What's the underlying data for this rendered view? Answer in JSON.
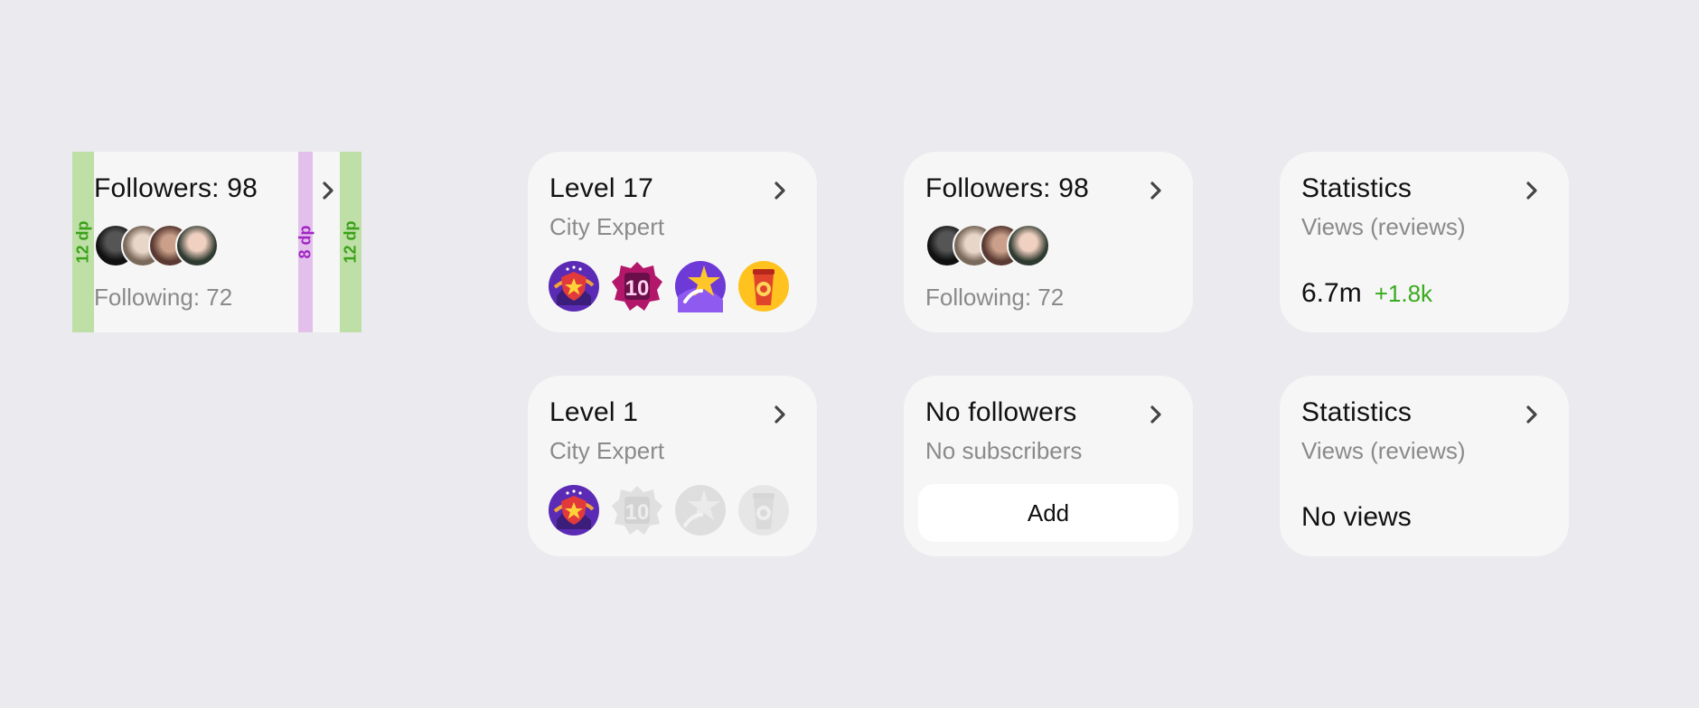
{
  "spec": {
    "title": "Followers: 98",
    "following": "Following: 72",
    "pad_left_label": "12 dp",
    "gap_label": "8 dp",
    "pad_right_label": "12 dp"
  },
  "cards": {
    "level17": {
      "title": "Level 17",
      "subtitle": "City Expert"
    },
    "followers": {
      "title": "Followers: 98",
      "following": "Following: 72"
    },
    "stats": {
      "title": "Statistics",
      "subtitle": "Views (reviews)",
      "value": "6.7m",
      "delta": "+1.8k"
    },
    "level1": {
      "title": "Level 1",
      "subtitle": "City Expert"
    },
    "nofollowers": {
      "title": "No followers",
      "subtitle": "No subscribers",
      "button": "Add"
    },
    "stats_empty": {
      "title": "Statistics",
      "subtitle": "Views (reviews)",
      "value": "No views"
    }
  },
  "icons": {
    "chevron": "chevron-right-icon",
    "badges": [
      "shield-star-badge-icon",
      "number-10-badge-icon",
      "star-badge-icon",
      "coffee-cup-badge-icon"
    ]
  },
  "colors": {
    "background": "#EBEAEF",
    "card": "#F6F6F6",
    "positive": "#3AAA1E",
    "padding_green": "#BEDFA6",
    "gap_purple": "#E3C0EC"
  }
}
